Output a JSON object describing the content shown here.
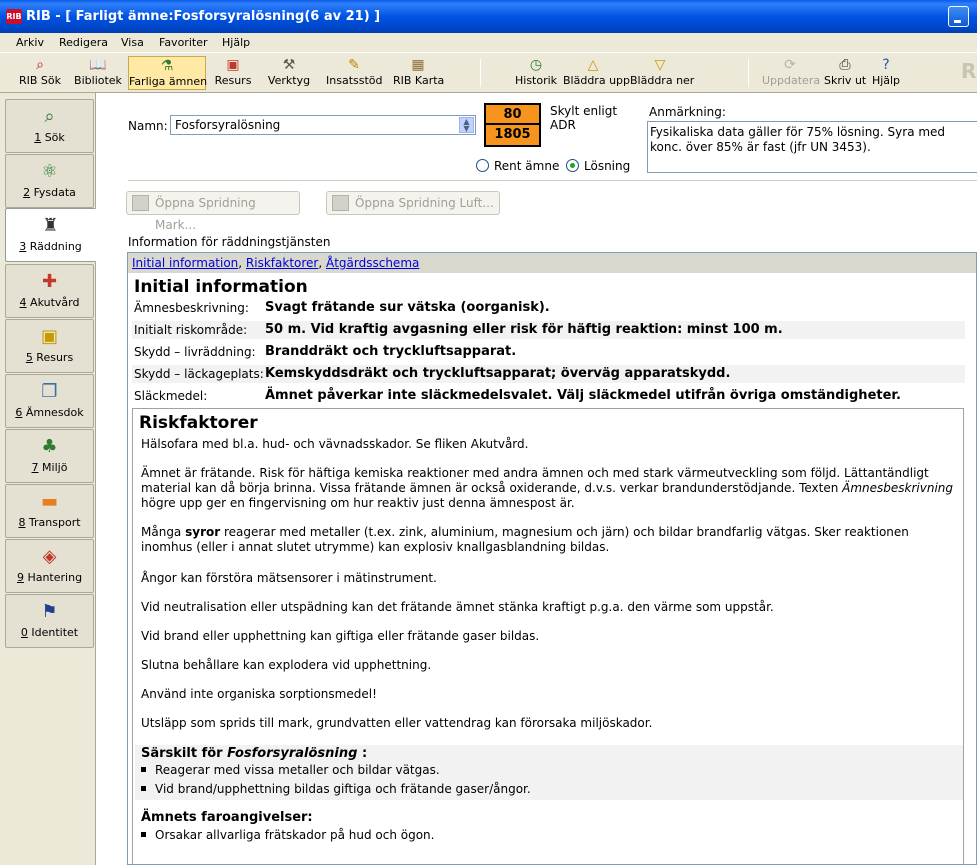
{
  "window": {
    "app_icon_text": "RIB",
    "title": "RIB - [ Farligt ämne:Fosforsyralösning(6 av 21) ]"
  },
  "menu": [
    "Arkiv",
    "Redigera",
    "Visa",
    "Favoriter",
    "Hjälp"
  ],
  "toolbar": {
    "buttons": [
      {
        "label": "RIB Sök",
        "icon": "rib-search-icon"
      },
      {
        "label": "Bibliotek",
        "icon": "book-icon"
      },
      {
        "label": "Farliga ämnen",
        "icon": "flask-icon",
        "active": true
      },
      {
        "label": "Resurs",
        "icon": "resource-icon"
      },
      {
        "label": "Verktyg",
        "icon": "tools-icon"
      },
      {
        "label": "Insatsstöd",
        "icon": "checklist-icon"
      },
      {
        "label": "RIB Karta",
        "icon": "map-icon"
      },
      {
        "label": "Historik",
        "icon": "history-icon"
      },
      {
        "label": "Bläddra upp",
        "icon": "arrow-up-icon"
      },
      {
        "label": "Bläddra ner",
        "icon": "arrow-down-icon"
      },
      {
        "label": "Uppdatera",
        "icon": "update-icon",
        "disabled": true
      },
      {
        "label": "Skriv ut",
        "icon": "printer-icon"
      },
      {
        "label": "Hjälp",
        "icon": "help-icon"
      }
    ],
    "watermark": "RI"
  },
  "nav": [
    {
      "key": "1",
      "label": " Sök",
      "icon": "search-icon"
    },
    {
      "key": "2",
      "label": " Fysdata",
      "icon": "molecule-icon"
    },
    {
      "key": "3",
      "label": " Räddning",
      "icon": "firefighter-icon",
      "active": true
    },
    {
      "key": "4",
      "label": " Akutvård",
      "icon": "first-aid-icon"
    },
    {
      "key": "5",
      "label": " Resurs",
      "icon": "resource-icon"
    },
    {
      "key": "6",
      "label": " Ämnesdok",
      "icon": "documents-icon"
    },
    {
      "key": "7",
      "label": " Miljö",
      "icon": "tree-icon"
    },
    {
      "key": "8",
      "label": " Transport",
      "icon": "transport-icon"
    },
    {
      "key": "9",
      "label": " Hantering",
      "icon": "hazard-icon"
    },
    {
      "key": "0",
      "label": " Identitet",
      "icon": "flags-icon"
    }
  ],
  "substance": {
    "name_label": "Namn:",
    "name_value": "Fosforsyralösning",
    "adr_hazard": "80",
    "adr_un": "1805",
    "skylt_line1": "Skylt enligt",
    "skylt_line2": "ADR",
    "radio_pure": "Rent ämne",
    "radio_solution": "Lösning",
    "selected": "Lösning",
    "remark_label": "Anmärkning:",
    "remark_text": "Fysikaliska data gäller för 75% lösning. Syra med konc. över 85% är fast (jfr UN 3453)."
  },
  "buttons": {
    "spread_ground": "Öppna Spridning Mark...",
    "spread_air": "Öppna Spridning Luft..."
  },
  "info": {
    "heading": "Information för räddningstjänsten",
    "links": [
      "Initial information",
      "Riskfaktorer",
      "Åtgärdsschema"
    ],
    "link_sep": ", ",
    "initial_title": "Initial information",
    "rows": [
      {
        "k": "Ämnesbeskrivning:",
        "v": "Svagt frätande sur vätska (oorganisk)."
      },
      {
        "k": "Initialt riskområde:",
        "v": "50 m. Vid kraftig avgasning eller risk för häftig reaktion: minst 100 m."
      },
      {
        "k": "Skydd – livräddning:",
        "v": "Branddräkt och tryckluftsapparat."
      },
      {
        "k": "Skydd – läckageplats:",
        "v": "Kemskyddsdräkt och tryckluftsapparat; överväg apparatskydd."
      },
      {
        "k": "Släckmedel:",
        "v": "Ämnet påverkar inte släckmedelsvalet. Välj släckmedel utifrån övriga omständigheter."
      }
    ],
    "risk_title": "Riskfaktorer",
    "risk_p1": "Hälsofara med bl.a. hud- och vävnadsskador. Se fliken Akutvård.",
    "risk_p2a": "Ämnet är frätande. Risk för häftiga kemiska reaktioner med andra ämnen och med stark värmeutveckling som följd. Lättantändligt material kan då börja brinna. Vissa frätande ämnen är också oxiderande, d.v.s. verkar brandunderstödjande. Texten ",
    "risk_p2_em": "Ämnesbeskrivning",
    "risk_p2b": " högre upp ger en fingervisning om hur reaktiv just denna ämnespost är.",
    "risk_p3a": "Många ",
    "risk_p3_strong": "syror",
    "risk_p3b": " reagerar med metaller (t.ex. zink, aluminium, magnesium och järn) och bildar brandfarlig vätgas. Sker reaktionen inomhus (eller i annat slutet utrymme) kan explosiv knallgasblandning bildas.",
    "risk_p4": "Ångor kan förstöra mätsensorer i mätinstrument.",
    "risk_p5": "Vid neutralisation eller utspädning kan det frätande ämnet stänka kraftigt p.g.a. den värme som uppstår.",
    "risk_p6": "Vid brand eller upphettning kan giftiga eller frätande gaser bildas.",
    "risk_p7": "Slutna behållare kan explodera vid upphettning.",
    "risk_p8": "Använd inte organiska sorptionsmedel!",
    "risk_p9": "Utsläpp som sprids till mark, grundvatten eller vattendrag kan förorsaka miljöskador.",
    "special_prefix": "Särskilt för ",
    "special_name": "Fosforsyralösning",
    "special_suffix": " :",
    "special_bullets": [
      "Reagerar med vissa metaller och bildar vätgas.",
      "Vid brand/upphettning bildas giftiga och frätande gaser/ångor."
    ],
    "hazard_title": "Ämnets faroangivelser:",
    "hazard_bullets": [
      "Orsakar allvarliga frätskador på hud och ögon."
    ]
  }
}
